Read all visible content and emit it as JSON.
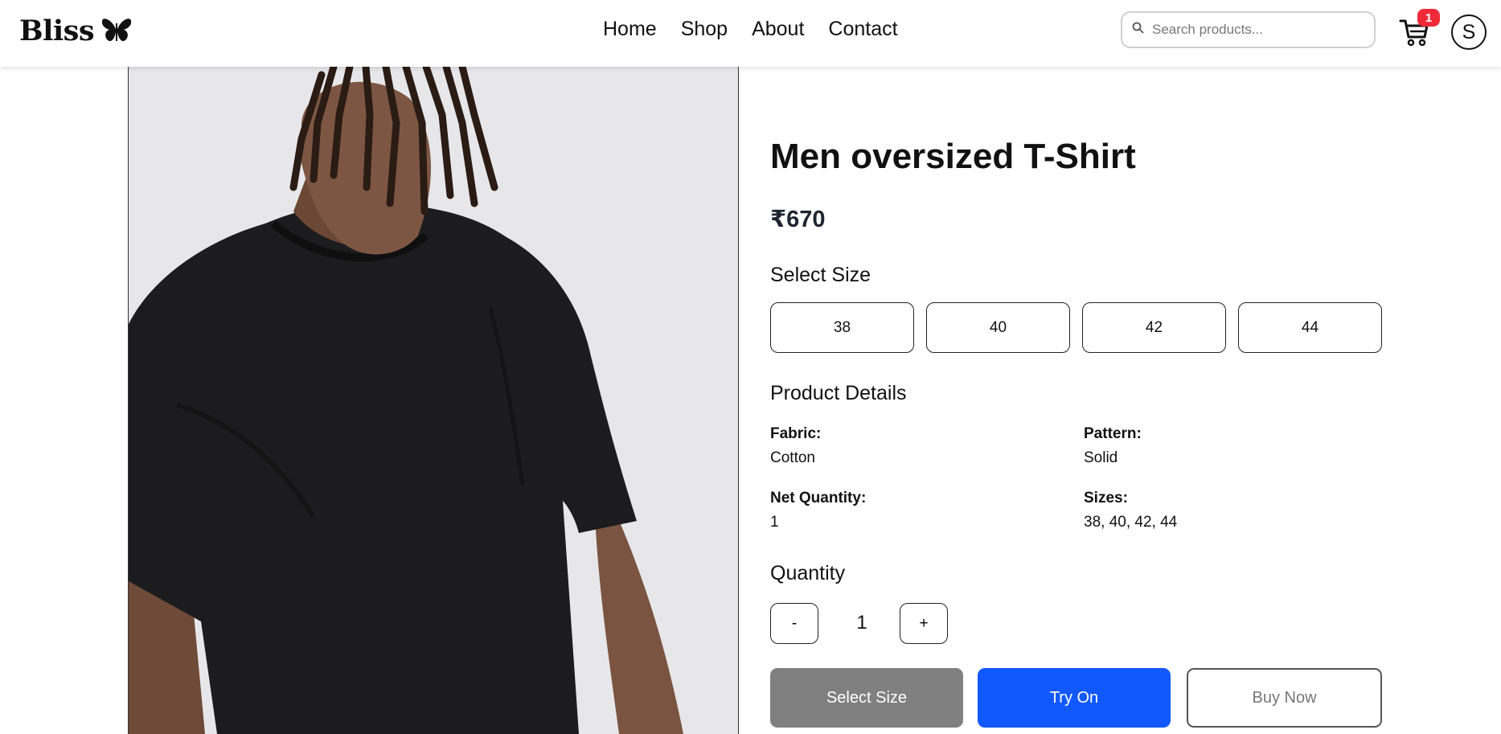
{
  "brand": {
    "name": "Bliss",
    "logo_icon": "butterfly-icon"
  },
  "nav": {
    "links": [
      "Home",
      "Shop",
      "About",
      "Contact"
    ]
  },
  "search": {
    "placeholder": "Search products...",
    "value": ""
  },
  "cart": {
    "count": "1",
    "badge_color": "#ef2b3a"
  },
  "user": {
    "avatar_initial": "S"
  },
  "product": {
    "title": "Men oversized T-Shirt",
    "price": "₹670",
    "image_alt_icon": "product-photo",
    "select_size_heading": "Select Size",
    "sizes": [
      "38",
      "40",
      "42",
      "44"
    ],
    "details_heading": "Product Details",
    "details": [
      {
        "label": "Fabric:",
        "value": "Cotton"
      },
      {
        "label": "Pattern:",
        "value": "Solid"
      },
      {
        "label": "Net Quantity:",
        "value": "1"
      },
      {
        "label": "Sizes:",
        "value": "38, 40, 42, 44"
      }
    ],
    "quantity_heading": "Quantity",
    "quantity": {
      "minus": "-",
      "value": "1",
      "plus": "+"
    },
    "actions": {
      "select_size": "Select Size",
      "try_on": "Try On",
      "buy_now": "Buy Now"
    }
  },
  "colors": {
    "primary": "#1158ff",
    "disabled": "#808080",
    "image_bg": "#e7e7ea"
  }
}
